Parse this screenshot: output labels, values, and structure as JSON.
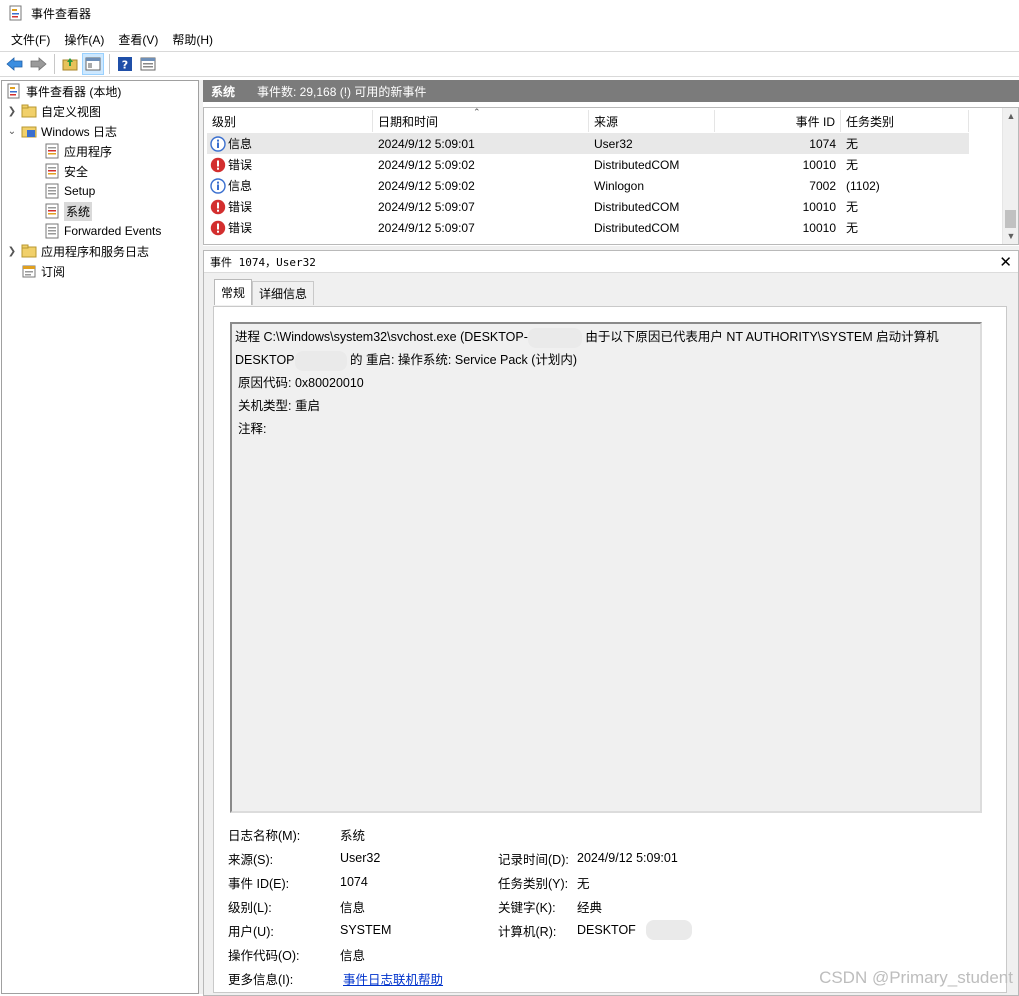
{
  "window": {
    "title": "事件查看器"
  },
  "menu": [
    "文件(F)",
    "操作(A)",
    "查看(V)",
    "帮助(H)"
  ],
  "toolbar": {
    "buttons": [
      "back-icon",
      "forward-icon",
      "folder-up-icon",
      "show-pane-icon",
      "help-icon",
      "properties-icon"
    ]
  },
  "tree": {
    "root": "事件查看器 (本地)",
    "custom_views": "自定义视图",
    "windows_logs": "Windows 日志",
    "logs": [
      "应用程序",
      "安全",
      "Setup",
      "系统",
      "Forwarded Events"
    ],
    "app_services": "应用程序和服务日志",
    "subscriptions": "订阅"
  },
  "header": {
    "log_name": "系统",
    "summary": "事件数: 29,168 (!) 可用的新事件"
  },
  "grid": {
    "columns": [
      "级别",
      "日期和时间",
      "来源",
      "事件 ID",
      "任务类别"
    ],
    "rows": [
      {
        "level": "信息",
        "type": "info",
        "datetime": "2024/9/12 5:09:01",
        "source": "User32",
        "id": "1074",
        "category": "无"
      },
      {
        "level": "错误",
        "type": "error",
        "datetime": "2024/9/12 5:09:02",
        "source": "DistributedCOM",
        "id": "10010",
        "category": "无"
      },
      {
        "level": "信息",
        "type": "info",
        "datetime": "2024/9/12 5:09:02",
        "source": "Winlogon",
        "id": "7002",
        "category": "(1102)"
      },
      {
        "level": "错误",
        "type": "error",
        "datetime": "2024/9/12 5:09:07",
        "source": "DistributedCOM",
        "id": "10010",
        "category": "无"
      },
      {
        "level": "错误",
        "type": "error",
        "datetime": "2024/9/12 5:09:07",
        "source": "DistributedCOM",
        "id": "10010",
        "category": "无"
      }
    ]
  },
  "detail": {
    "title": "事件 1074，User32",
    "tabs": [
      "常规",
      "详细信息"
    ],
    "message": {
      "l1_a": "进程 C:\\Windows\\system32\\svchost.exe (DESKTOP-",
      "l1_b": "由于以下原因已代表用户 NT AUTHORITY\\SYSTEM 启动计算机",
      "l2_a": "DESKTOP",
      "l2_b": " 的 重启: 操作系统: Service Pack (计划内)",
      "l3": "原因代码: 0x80020010",
      "l4": "关机类型: 重启",
      "l5": "注释:"
    },
    "props": {
      "log_name_label": "日志名称(M):",
      "log_name": "系统",
      "source_label": "来源(S):",
      "source": "User32",
      "logged_label": "记录时间(D):",
      "logged": "2024/9/12 5:09:01",
      "event_id_label": "事件 ID(E):",
      "event_id": "1074",
      "task_label": "任务类别(Y):",
      "task": "无",
      "level_label": "级别(L):",
      "level": "信息",
      "keywords_label": "关键字(K):",
      "keywords": "经典",
      "user_label": "用户(U):",
      "user": "SYSTEM",
      "computer_label": "计算机(R):",
      "computer": "DESKTOF",
      "opcode_label": "操作代码(O):",
      "opcode": "信息",
      "more_label": "更多信息(I):",
      "more_link": "事件日志联机帮助"
    }
  },
  "watermark": "CSDN @Primary_student",
  "colors": {
    "header_bg": "#7b7b7b",
    "error": "#d32f2f",
    "info": "#3a6fcf",
    "link": "#0033cc"
  }
}
